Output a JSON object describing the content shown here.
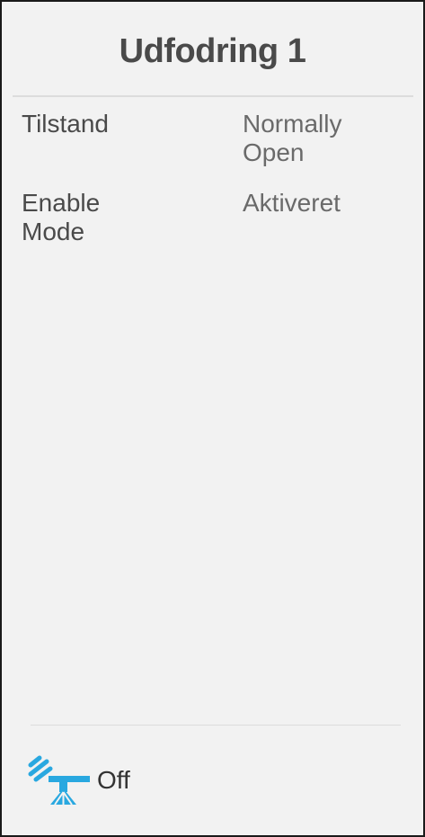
{
  "header": {
    "title": "Udfodring 1"
  },
  "details": [
    {
      "label_line1": "Tilstand",
      "label_line2": "",
      "value_line1": "Normally",
      "value_line2": "Open"
    },
    {
      "label_line1": "Enable",
      "label_line2": "Mode",
      "value_line1": "Aktiveret",
      "value_line2": ""
    }
  ],
  "status": {
    "icon": "feeder-icon",
    "icon_color": "#29a8e0",
    "text": "Off"
  }
}
